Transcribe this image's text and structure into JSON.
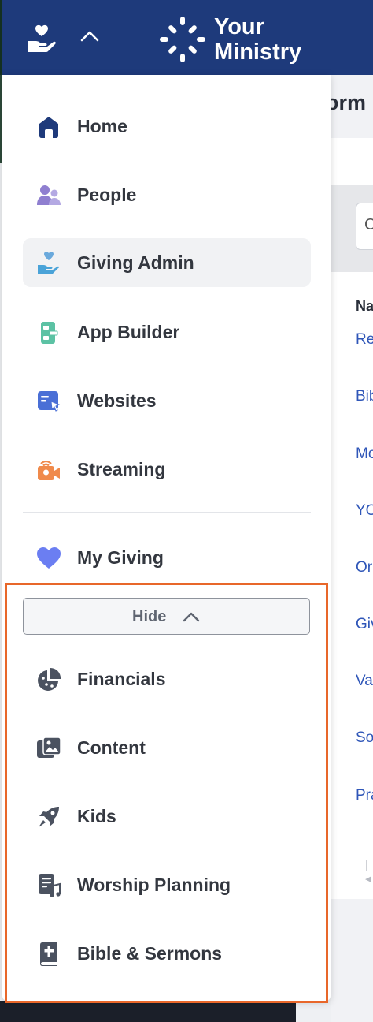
{
  "brand": {
    "line1": "Your",
    "line2": "Ministry"
  },
  "background_page": {
    "title_fragment": "orm l",
    "search_fragment": "C",
    "column_header_fragment": "Na",
    "row_fragments": [
      "Re",
      "Bib",
      "Mo",
      "YO",
      "Or",
      "Giv",
      "Va",
      "So",
      "Pra"
    ],
    "pager_fragment": "|◂"
  },
  "menu": {
    "items": [
      {
        "label": "Home",
        "icon": "home-icon",
        "color": "#1e3a7b"
      },
      {
        "label": "People",
        "icon": "people-icon",
        "color": "#8f7fd0"
      },
      {
        "label": "Giving Admin",
        "icon": "giving-admin-icon",
        "color": "#4aa3d8",
        "active": true
      },
      {
        "label": "App Builder",
        "icon": "app-builder-icon",
        "color": "#5cc2a4"
      },
      {
        "label": "Websites",
        "icon": "websites-icon",
        "color": "#4a6fd6"
      },
      {
        "label": "Streaming",
        "icon": "streaming-icon",
        "color": "#f08a4b"
      }
    ],
    "my_giving": {
      "label": "My Giving",
      "icon": "heart-icon",
      "color": "#6b7ef2"
    },
    "hide_button": {
      "label": "Hide"
    },
    "extra_items": [
      {
        "label": "Financials",
        "icon": "financials-icon"
      },
      {
        "label": "Content",
        "icon": "content-icon"
      },
      {
        "label": "Kids",
        "icon": "rocket-icon"
      },
      {
        "label": "Worship Planning",
        "icon": "worship-planning-icon"
      },
      {
        "label": "Bible & Sermons",
        "icon": "bible-icon"
      }
    ],
    "extra_icon_color": "#4b5260"
  },
  "colors": {
    "topbar": "#1e3a7b",
    "highlight_border": "#e8672a"
  }
}
